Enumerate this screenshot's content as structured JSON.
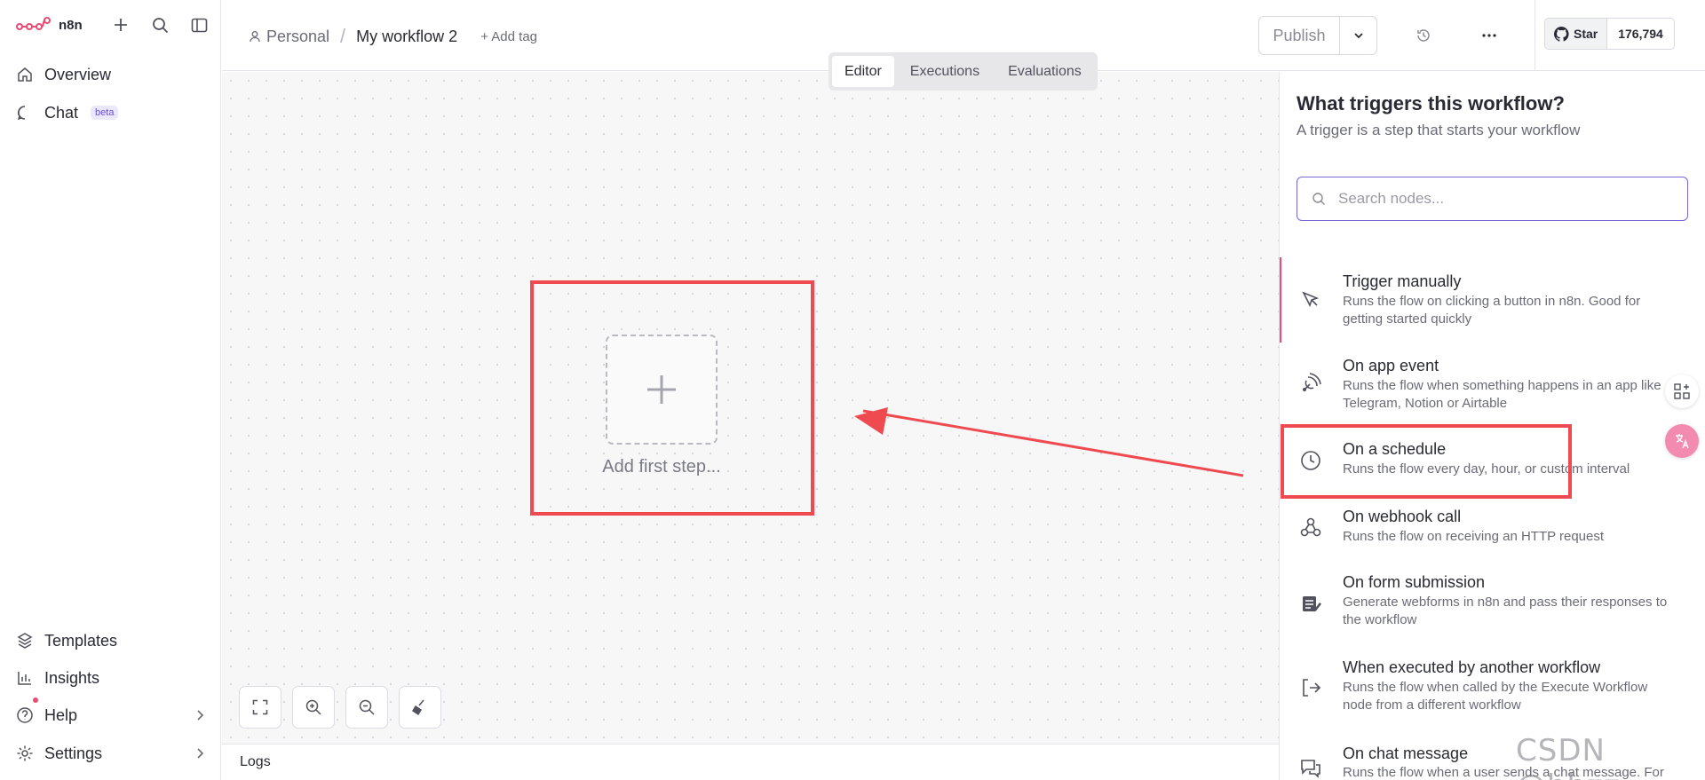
{
  "sidebar": {
    "logo_text": "n8n",
    "items": [
      {
        "label": "Overview"
      },
      {
        "label": "Chat",
        "badge": "beta"
      }
    ],
    "bottom_items": [
      {
        "label": "Templates"
      },
      {
        "label": "Insights"
      },
      {
        "label": "Help"
      },
      {
        "label": "Settings"
      }
    ]
  },
  "header": {
    "project": "Personal",
    "workflow_name": "My workflow 2",
    "add_tag": "+ Add tag",
    "publish_label": "Publish",
    "star_label": "Star",
    "star_count": "176,794"
  },
  "tabs": [
    {
      "label": "Editor",
      "active": true
    },
    {
      "label": "Executions",
      "active": false
    },
    {
      "label": "Evaluations",
      "active": false
    }
  ],
  "canvas": {
    "add_first_step": "Add first step..."
  },
  "logs": {
    "label": "Logs"
  },
  "panel": {
    "title": "What triggers this workflow?",
    "subtitle": "A trigger is a step that starts your workflow",
    "search_placeholder": "Search nodes...",
    "triggers": [
      {
        "name": "Trigger manually",
        "desc": "Runs the flow on clicking a button in n8n. Good for getting started quickly",
        "icon": "cursor-icon"
      },
      {
        "name": "On app event",
        "desc": "Runs the flow when something happens in an app like Telegram, Notion or Airtable",
        "icon": "satellite-icon"
      },
      {
        "name": "On a schedule",
        "desc": "Runs the flow every day, hour, or custom interval",
        "icon": "clock-icon"
      },
      {
        "name": "On webhook call",
        "desc": "Runs the flow on receiving an HTTP request",
        "icon": "webhook-icon"
      },
      {
        "name": "On form submission",
        "desc": "Generate webforms in n8n and pass their responses to the workflow",
        "icon": "form-icon"
      },
      {
        "name": "When executed by another workflow",
        "desc": "Runs the flow when called by the Execute Workflow node from a different workflow",
        "icon": "sign-in-icon"
      },
      {
        "name": "On chat message",
        "desc": "Runs the flow when a user sends a chat message. For",
        "icon": "chat-icon"
      }
    ]
  },
  "watermark": "CSDN @hhzz",
  "colors": {
    "accent": "#ea4b71",
    "highlight": "#ee4a4f",
    "search_border": "#7a67d6"
  }
}
